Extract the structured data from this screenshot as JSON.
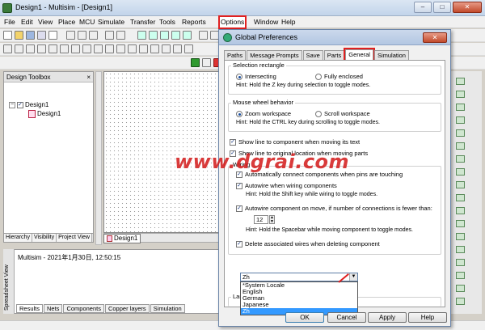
{
  "window": {
    "title": "Design1 - Multisim - [Design1]",
    "controls": {
      "minimize": "–",
      "maximize": "□",
      "close": "✕"
    }
  },
  "menu": {
    "items": [
      "File",
      "Edit",
      "View",
      "Place",
      "MCU",
      "Simulate",
      "Transfer",
      "Tools",
      "Reports",
      "Options",
      "Window",
      "Help"
    ],
    "highlighted": "Options"
  },
  "toolbox": {
    "title": "Design Toolbox",
    "close": "×",
    "tree_root": "Design1",
    "tree_child": "Design1",
    "tabs": [
      "Hierarchy",
      "Visibility",
      "Project View"
    ]
  },
  "sheet_tab": "Design1",
  "spreadsheet": {
    "vertical_label": "Spreadsheet View",
    "message": "Multisim  -  2021年1月30日, 12:50:15",
    "tabs": [
      "Results",
      "Nets",
      "Components",
      "Copper layers",
      "Simulation"
    ]
  },
  "watermark": "www.dgrai.com",
  "dialog": {
    "title": "Global Preferences",
    "close": "✕",
    "tabs": [
      "Paths",
      "Message Prompts",
      "Save",
      "Parts",
      "General",
      "Simulation"
    ],
    "active_tab": "General",
    "selection": {
      "label": "Selection rectangle",
      "opt1": "Intersecting",
      "opt2": "Fully enclosed",
      "hint": "Hint: Hold the Z key during selection to toggle modes."
    },
    "mouse": {
      "label": "Mouse wheel behavior",
      "opt1": "Zoom workspace",
      "opt2": "Scroll workspace",
      "hint": "Hint: Hold the CTRL key during scrolling to toggle modes."
    },
    "show_line_text": "Show line to component when moving its text",
    "show_line_orig": "Show line to original location when moving parts",
    "wiring": {
      "label": "Wiring",
      "auto_connect": "Automatically connect components when pins are touching",
      "autowire": "Autowire when wiring components",
      "autowire_hint": "Hint: Hold the Shift key while wiring to toggle modes.",
      "autowire_move": "Autowire component on move, if number of connections is fewer than:",
      "connections": "12",
      "move_hint": "Hint: Hold the Spacebar while moving component to toggle modes.",
      "delete_wires": "Delete associated wires when deleting component"
    },
    "language": {
      "label": "Language",
      "selected": "Zh",
      "options": [
        "*System Locale",
        "English",
        "German",
        "Japanese",
        "Zh"
      ]
    },
    "buttons": {
      "ok": "OK",
      "cancel": "Cancel",
      "apply": "Apply",
      "help": "Help"
    }
  },
  "colors": {
    "annotation_red": "#e02020",
    "selection_blue": "#3399ff"
  }
}
